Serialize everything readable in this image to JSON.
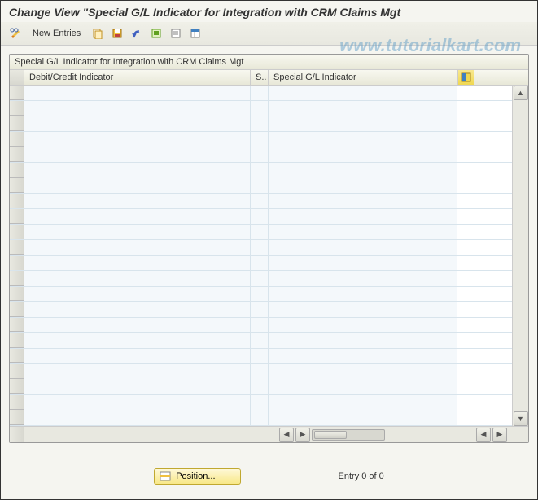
{
  "title": "Change View \"Special G/L Indicator for Integration with CRM Claims Mgt",
  "toolbar": {
    "new_entries": "New Entries"
  },
  "table": {
    "title": "Special G/L Indicator for Integration with CRM Claims Mgt",
    "columns": {
      "col1": "Debit/Credit Indicator",
      "col2": "S..",
      "col3": "Special G/L Indicator"
    }
  },
  "footer": {
    "position_btn": "Position...",
    "entry_text": "Entry 0 of 0"
  },
  "watermark": "www.tutorialkart.com"
}
